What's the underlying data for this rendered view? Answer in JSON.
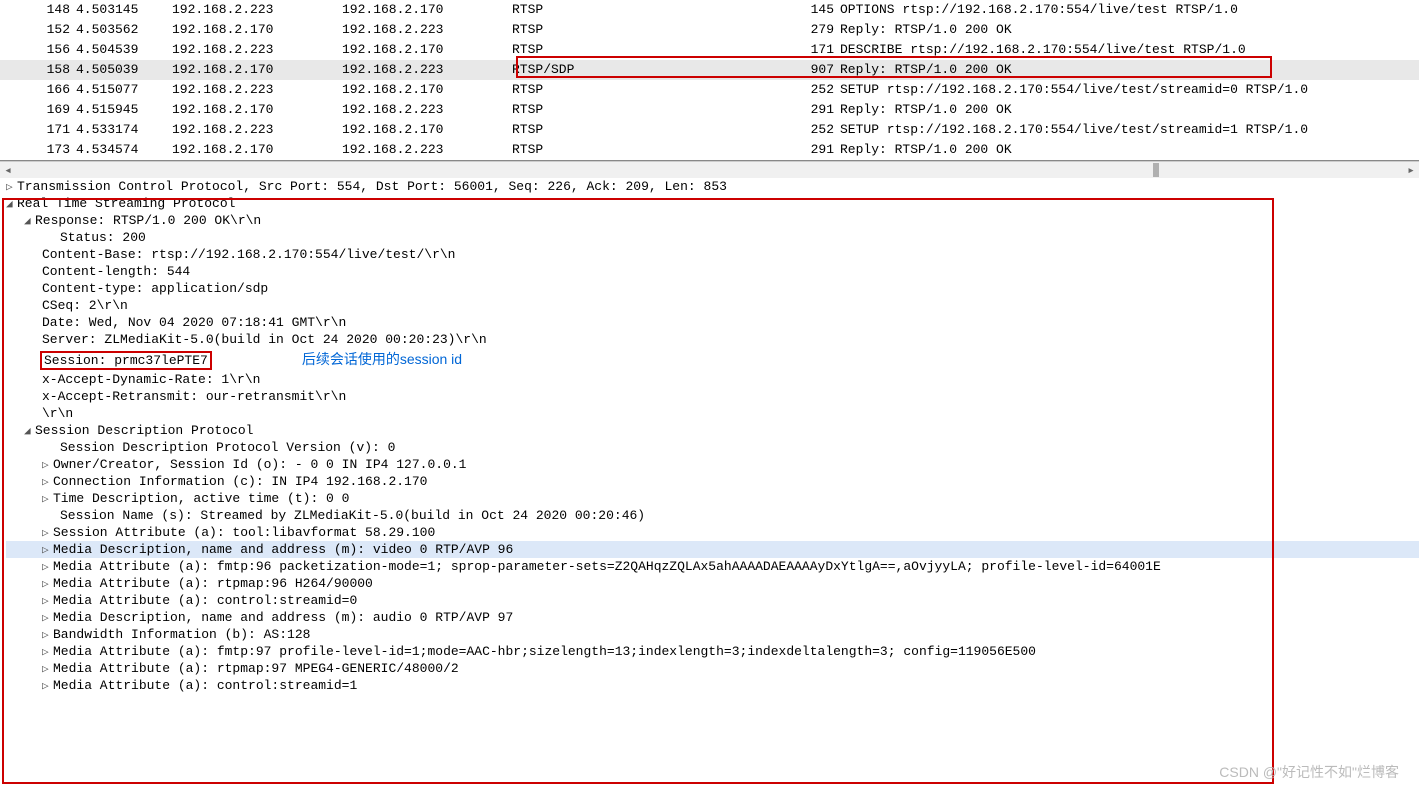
{
  "packets": [
    {
      "no": "148",
      "time": "4.503145",
      "src": "192.168.2.223",
      "dst": "192.168.2.170",
      "proto": "RTSP",
      "len": "145",
      "info": "OPTIONS rtsp://192.168.2.170:554/live/test RTSP/1.0"
    },
    {
      "no": "152",
      "time": "4.503562",
      "src": "192.168.2.170",
      "dst": "192.168.2.223",
      "proto": "RTSP",
      "len": "279",
      "info": "Reply: RTSP/1.0 200 OK"
    },
    {
      "no": "156",
      "time": "4.504539",
      "src": "192.168.2.223",
      "dst": "192.168.2.170",
      "proto": "RTSP",
      "len": "171",
      "info": "DESCRIBE rtsp://192.168.2.170:554/live/test RTSP/1.0"
    },
    {
      "no": "158",
      "time": "4.505039",
      "src": "192.168.2.170",
      "dst": "192.168.2.223",
      "proto": "RTSP/SDP",
      "len": "907",
      "info": "Reply: RTSP/1.0 200 OK",
      "selected": true
    },
    {
      "no": "166",
      "time": "4.515077",
      "src": "192.168.2.223",
      "dst": "192.168.2.170",
      "proto": "RTSP",
      "len": "252",
      "info": "SETUP rtsp://192.168.2.170:554/live/test/streamid=0 RTSP/1.0"
    },
    {
      "no": "169",
      "time": "4.515945",
      "src": "192.168.2.170",
      "dst": "192.168.2.223",
      "proto": "RTSP",
      "len": "291",
      "info": "Reply: RTSP/1.0 200 OK"
    },
    {
      "no": "171",
      "time": "4.533174",
      "src": "192.168.2.223",
      "dst": "192.168.2.170",
      "proto": "RTSP",
      "len": "252",
      "info": "SETUP rtsp://192.168.2.170:554/live/test/streamid=1 RTSP/1.0"
    },
    {
      "no": "173",
      "time": "4.534574",
      "src": "192.168.2.170",
      "dst": "192.168.2.223",
      "proto": "RTSP",
      "len": "291",
      "info": "Reply: RTSP/1.0 200 OK"
    }
  ],
  "tree": {
    "tcp_line": "Transmission Control Protocol, Src Port: 554, Dst Port: 56001, Seq: 226, Ack: 209, Len: 853",
    "rtsp_root": "Real Time Streaming Protocol",
    "response": "Response: RTSP/1.0 200 OK\\r\\n",
    "status": "Status: 200",
    "content_base": "Content-Base: rtsp://192.168.2.170:554/live/test/\\r\\n",
    "content_length": "Content-length: 544",
    "content_type": "Content-type: application/sdp",
    "cseq": "CSeq: 2\\r\\n",
    "date": "Date: Wed, Nov 04 2020 07:18:41 GMT\\r\\n",
    "server": "Server: ZLMediaKit-5.0(build in Oct 24 2020 00:20:23)\\r\\n",
    "session": "Session: prmc37lePTE7",
    "x_accept_dyn": "x-Accept-Dynamic-Rate: 1\\r\\n",
    "x_accept_ret": "x-Accept-Retransmit: our-retransmit\\r\\n",
    "crlf": "\\r\\n",
    "sdp_root": "Session Description Protocol",
    "sdp_v": "Session Description Protocol Version (v): 0",
    "sdp_o": "Owner/Creator, Session Id (o): - 0 0 IN IP4 127.0.0.1",
    "sdp_c": "Connection Information (c): IN IP4 192.168.2.170",
    "sdp_t": "Time Description, active time (t): 0 0",
    "sdp_s": "Session Name (s): Streamed by ZLMediaKit-5.0(build in Oct 24 2020 00:20:46)",
    "sdp_a_tool": "Session Attribute (a): tool:libavformat 58.29.100",
    "sdp_m_video": "Media Description, name and address (m): video 0 RTP/AVP 96",
    "sdp_a_fmtp96": "Media Attribute (a): fmtp:96 packetization-mode=1; sprop-parameter-sets=Z2QAHqzZQLAx5ahAAAADAEAAAAyDxYtlgA==,aOvjyyLA; profile-level-id=64001E",
    "sdp_a_rtpmap96": "Media Attribute (a): rtpmap:96 H264/90000",
    "sdp_a_ctrl0": "Media Attribute (a): control:streamid=0",
    "sdp_m_audio": "Media Description, name and address (m): audio 0 RTP/AVP 97",
    "sdp_b": "Bandwidth Information (b): AS:128",
    "sdp_a_fmtp97": "Media Attribute (a): fmtp:97 profile-level-id=1;mode=AAC-hbr;sizelength=13;indexlength=3;indexdeltalength=3; config=119056E500",
    "sdp_a_rtpmap97": "Media Attribute (a): rtpmap:97 MPEG4-GENERIC/48000/2",
    "sdp_a_ctrl1": "Media Attribute (a): control:streamid=1"
  },
  "annotation": "后续会话使用的session id",
  "watermark": "CSDN @\"好记性不如\"烂博客"
}
